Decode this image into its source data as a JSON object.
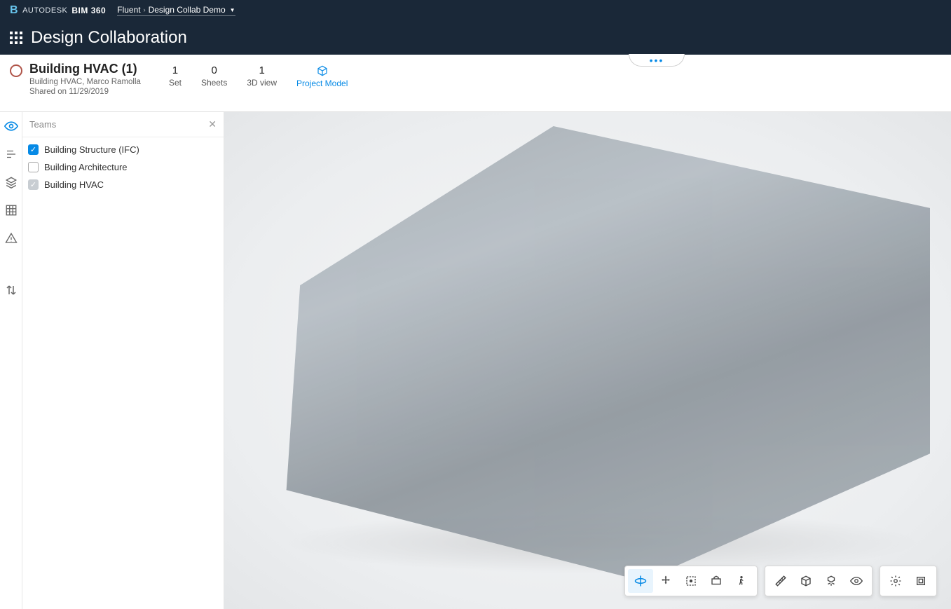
{
  "header": {
    "brand_prefix": "AUTODESK",
    "brand_product": "BIM 360",
    "breadcrumb_root": "Fluent",
    "breadcrumb_project": "Design Collab Demo",
    "module_title": "Design Collaboration"
  },
  "package": {
    "title": "Building HVAC (1)",
    "subtitle1": "Building HVAC, Marco Ramolla",
    "subtitle2": "Shared on 11/29/2019",
    "stats": [
      {
        "value": "1",
        "label": "Set"
      },
      {
        "value": "0",
        "label": "Sheets"
      },
      {
        "value": "1",
        "label": "3D view"
      },
      {
        "value": "",
        "label": "Project Model",
        "icon": true,
        "active": true
      }
    ]
  },
  "teams": {
    "title": "Teams",
    "items": [
      {
        "label": "Building Structure (IFC)",
        "state": "checked"
      },
      {
        "label": "Building Architecture",
        "state": "unchecked"
      },
      {
        "label": "Building HVAC",
        "state": "checked-grey"
      }
    ]
  },
  "rail": {
    "icons": [
      {
        "name": "eye-icon",
        "active": true
      },
      {
        "name": "levels-icon"
      },
      {
        "name": "layers-icon"
      },
      {
        "name": "grid-icon"
      },
      {
        "name": "warning-icon"
      },
      {
        "name": "compare-icon"
      }
    ]
  },
  "viewer_toolbar": {
    "group1": [
      {
        "name": "orbit-icon",
        "active": true
      },
      {
        "name": "pan-icon"
      },
      {
        "name": "zoom-extents-icon"
      },
      {
        "name": "first-person-icon"
      },
      {
        "name": "walk-icon"
      }
    ],
    "group2": [
      {
        "name": "measure-icon"
      },
      {
        "name": "section-icon"
      },
      {
        "name": "explode-icon"
      },
      {
        "name": "visibility-icon"
      }
    ],
    "group3": [
      {
        "name": "settings-icon"
      },
      {
        "name": "fullscreen-icon"
      }
    ]
  }
}
